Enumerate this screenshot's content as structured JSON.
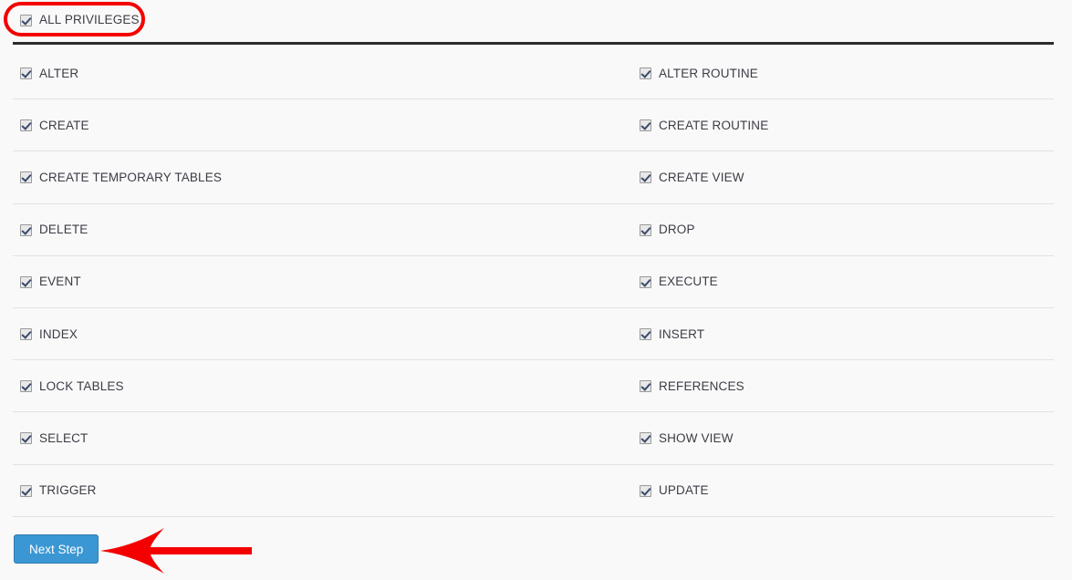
{
  "header": {
    "all_privileges_label": "ALL PRIVILEGES",
    "checked": true
  },
  "privileges": {
    "left_column": [
      {
        "label": "ALTER",
        "checked": true
      },
      {
        "label": "CREATE",
        "checked": true
      },
      {
        "label": "CREATE TEMPORARY TABLES",
        "checked": true
      },
      {
        "label": "DELETE",
        "checked": true
      },
      {
        "label": "EVENT",
        "checked": true
      },
      {
        "label": "INDEX",
        "checked": true
      },
      {
        "label": "LOCK TABLES",
        "checked": true
      },
      {
        "label": "SELECT",
        "checked": true
      },
      {
        "label": "TRIGGER",
        "checked": true
      }
    ],
    "right_column": [
      {
        "label": "ALTER ROUTINE",
        "checked": true
      },
      {
        "label": "CREATE ROUTINE",
        "checked": true
      },
      {
        "label": "CREATE VIEW",
        "checked": true
      },
      {
        "label": "DROP",
        "checked": true
      },
      {
        "label": "EXECUTE",
        "checked": true
      },
      {
        "label": "INSERT",
        "checked": true
      },
      {
        "label": "REFERENCES",
        "checked": true
      },
      {
        "label": "SHOW VIEW",
        "checked": true
      },
      {
        "label": "UPDATE",
        "checked": true
      }
    ]
  },
  "footer": {
    "next_button_label": "Next Step"
  },
  "annotations": {
    "highlight_color": "#f40000",
    "arrow_color": "#f40000",
    "highlight_target": "ALL PRIVILEGES",
    "arrow_target": "Next Step"
  },
  "colors": {
    "background": "#f9f9f9",
    "button": "#3b97d3",
    "button_border": "#2f7cae",
    "button_text": "#ffffff",
    "text": "#3c3c46",
    "rule": "#2b2b2b",
    "separator": "#e2e2e2"
  }
}
